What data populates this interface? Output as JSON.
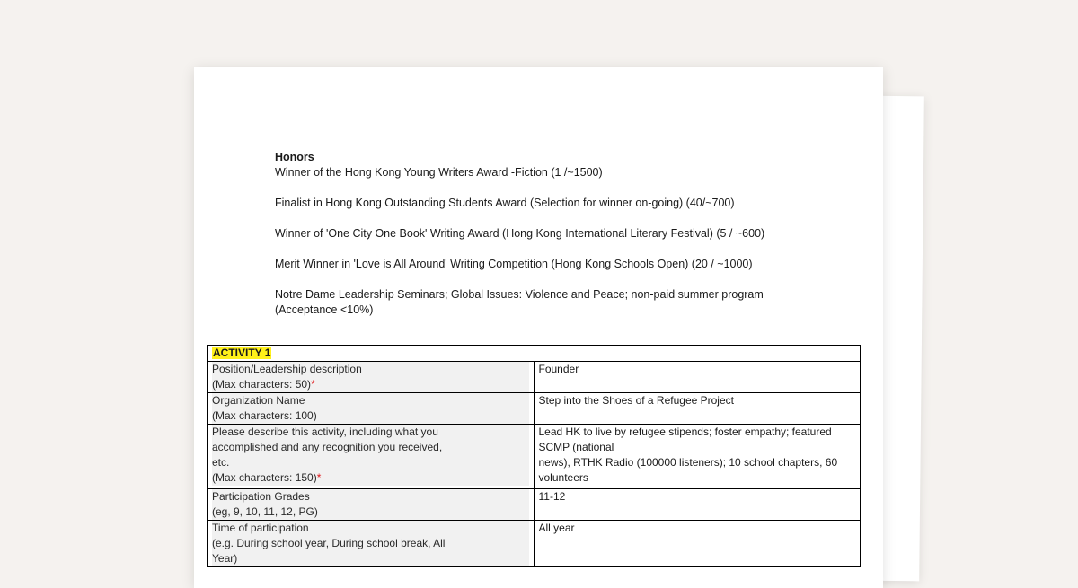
{
  "honors": {
    "heading": "Honors",
    "items": [
      "Winner of the Hong Kong Young Writers Award -Fiction (1 /~1500)",
      "Finalist in Hong Kong Outstanding Students Award (Selection for winner on-going) (40/~700)",
      "Winner of 'One City One Book' Writing Award (Hong Kong International Literary Festival) (5 / ~600)",
      "Merit Winner in 'Love is All Around' Writing Competition (Hong Kong Schools Open) (20 / ~1000)",
      "Notre Dame Leadership Seminars; Global Issues: Violence and Peace; non-paid summer program",
      "(Acceptance <10%)"
    ]
  },
  "activity": {
    "title": "ACTIVITY 1",
    "required_mark": "*",
    "rows": [
      {
        "label_lines": [
          "Position/Leadership description",
          "(Max characters: 50)"
        ],
        "required": true,
        "value": "Founder"
      },
      {
        "label_lines": [
          "Organization Name",
          "(Max characters: 100)"
        ],
        "required": false,
        "value": "Step into the Shoes of a Refugee Project"
      },
      {
        "label_lines": [
          "Please describe this activity, including what you",
          "accomplished and any recognition you received,",
          "etc.",
          "(Max characters: 150)"
        ],
        "required": true,
        "value_lines": [
          "Lead HK to live by refugee stipends; foster empathy; featured SCMP (national",
          "news), RTHK Radio (100000 listeners); 10 school chapters, 60 volunteers"
        ]
      },
      {
        "label_lines": [
          "Participation Grades",
          "(eg, 9, 10, 11, 12, PG)"
        ],
        "required": false,
        "value": "11-12"
      },
      {
        "label_lines": [
          "Time of participation",
          "(e.g. During school year, During school break, All",
          "Year)"
        ],
        "required": false,
        "value": "All year"
      }
    ]
  }
}
